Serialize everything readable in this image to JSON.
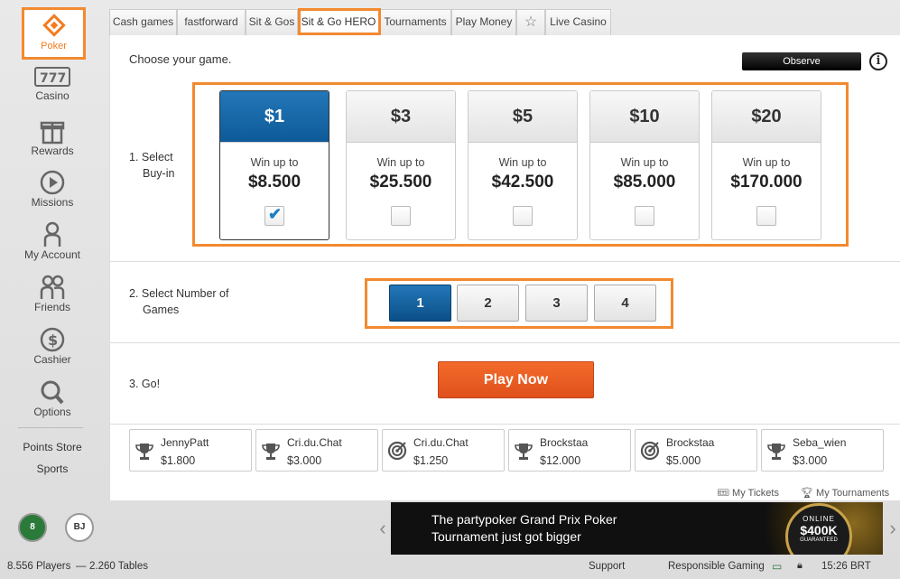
{
  "sidebar": {
    "poker": "Poker",
    "casino": "Casino",
    "rewards": "Rewards",
    "missions": "Missions",
    "my_account": "My Account",
    "friends": "Friends",
    "cashier": "Cashier",
    "options": "Options",
    "points_store": "Points Store",
    "sports": "Sports"
  },
  "tabs": [
    "Cash games",
    "fastforward",
    "Sit & Gos",
    "Sit & Go HERO",
    "Tournaments",
    "Play Money",
    "Live Casino"
  ],
  "active_tab": "Sit & Go HERO",
  "main": {
    "choose": "Choose your game.",
    "observe": "Observe",
    "info": "i",
    "step1_line1": "1. Select",
    "step1_line2": "Buy-in",
    "step2_line1": "2. Select Number of",
    "step2_line2": "Games",
    "step3": "3. Go!",
    "play_now": "Play Now"
  },
  "buyins": [
    {
      "price": "$1",
      "win_label": "Win up to",
      "amount": "$8.500",
      "selected": true
    },
    {
      "price": "$3",
      "win_label": "Win up to",
      "amount": "$25.500",
      "selected": false
    },
    {
      "price": "$5",
      "win_label": "Win up to",
      "amount": "$42.500",
      "selected": false
    },
    {
      "price": "$10",
      "win_label": "Win up to",
      "amount": "$85.000",
      "selected": false
    },
    {
      "price": "$20",
      "win_label": "Win up to",
      "amount": "$170.000",
      "selected": false
    }
  ],
  "games": [
    "1",
    "2",
    "3",
    "4"
  ],
  "games_selected": "1",
  "winners": [
    {
      "name": "JennyPatt",
      "amount": "$1.800",
      "icon": "trophy-icon"
    },
    {
      "name": "Cri.du.Chat",
      "amount": "$3.000",
      "icon": "trophy-icon"
    },
    {
      "name": "Cri.du.Chat",
      "amount": "$1.250",
      "icon": "target-icon"
    },
    {
      "name": "Brockstaa",
      "amount": "$12.000",
      "icon": "trophy-icon"
    },
    {
      "name": "Brockstaa",
      "amount": "$5.000",
      "icon": "target-icon"
    },
    {
      "name": "Seba_wien",
      "amount": "$3.000",
      "icon": "trophy-icon"
    }
  ],
  "links": {
    "my_tickets": "My Tickets",
    "my_tournaments": "My Tournaments"
  },
  "banner": {
    "line1": "The partypoker Grand Prix Poker",
    "line2": "Tournament just got bigger",
    "badge_top": "ONLINE",
    "badge_amount": "$400K",
    "badge_sub": "GUARANTEED"
  },
  "status": {
    "players": "8.556 Players",
    "sep": "—",
    "tables": "2.260 Tables",
    "support": "Support",
    "responsible": "Responsible Gaming",
    "time": "15:26 BRT"
  },
  "colors": {
    "accent_orange": "#f28a30",
    "selected_blue": "#1565a8",
    "play_orange": "#f05a22"
  }
}
